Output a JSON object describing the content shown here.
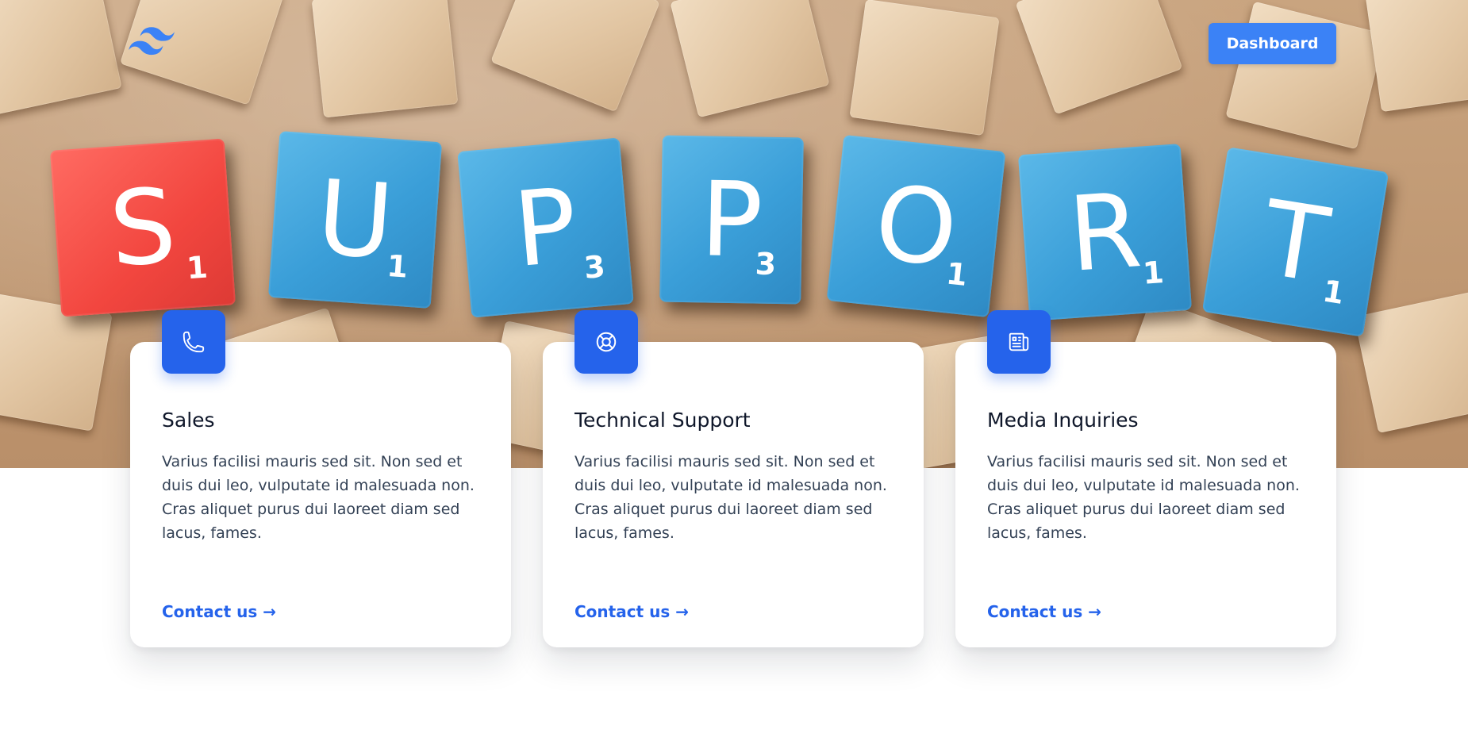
{
  "hero": {
    "tiles": [
      {
        "letter": "S",
        "score": "1"
      },
      {
        "letter": "U",
        "score": "1"
      },
      {
        "letter": "P",
        "score": "3"
      },
      {
        "letter": "P",
        "score": "3"
      },
      {
        "letter": "O",
        "score": "1"
      },
      {
        "letter": "R",
        "score": "1"
      },
      {
        "letter": "T",
        "score": "1"
      }
    ]
  },
  "header": {
    "logo_icon": "tailwind-logo-icon",
    "dashboard_label": "Dashboard"
  },
  "colors": {
    "accent": "#2563eb",
    "button": "#3b82f6",
    "tile_blue": "#3a9ed8",
    "tile_red": "#f2463f"
  },
  "cards": [
    {
      "icon": "phone-icon",
      "title": "Sales",
      "body": "Varius facilisi mauris sed sit. Non sed et duis dui leo, vulputate id malesuada non. Cras aliquet purus dui laoreet diam sed lacus, fames.",
      "link": "Contact us →"
    },
    {
      "icon": "lifebuoy-icon",
      "title": "Technical Support",
      "body": "Varius facilisi mauris sed sit. Non sed et duis dui leo, vulputate id malesuada non. Cras aliquet purus dui laoreet diam sed lacus, fames.",
      "link": "Contact us →"
    },
    {
      "icon": "newspaper-icon",
      "title": "Media Inquiries",
      "body": "Varius facilisi mauris sed sit. Non sed et duis dui leo, vulputate id malesuada non. Cras aliquet purus dui laoreet diam sed lacus, fames.",
      "link": "Contact us →"
    }
  ]
}
